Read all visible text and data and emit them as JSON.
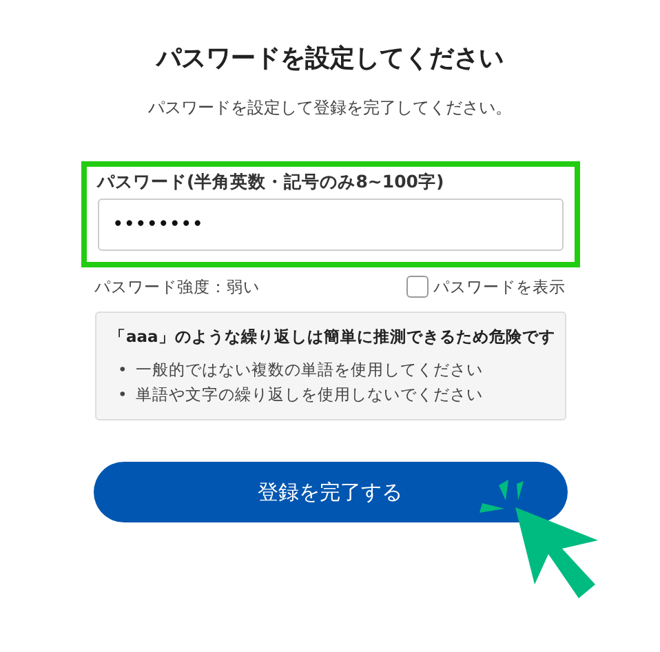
{
  "title": "パスワードを設定してください",
  "subtitle": "パスワードを設定して登録を完了してください。",
  "password_field": {
    "label": "パスワード(半角英数・記号のみ8~100字)",
    "value": "••••••••",
    "highlighted": true
  },
  "strength": "パスワード強度：弱い",
  "show_password": {
    "label": "パスワードを表示",
    "checked": false
  },
  "warning": {
    "title": "「aaa」のような繰り返しは簡単に推測できるため危険です",
    "tips": [
      {
        "bullet": "•",
        "text": "一般的ではない複数の単語を使用してください"
      },
      {
        "bullet": "•",
        "text": "単語や文字の繰り返しを使用しないでください"
      }
    ]
  },
  "submit_button": "登録を完了する"
}
